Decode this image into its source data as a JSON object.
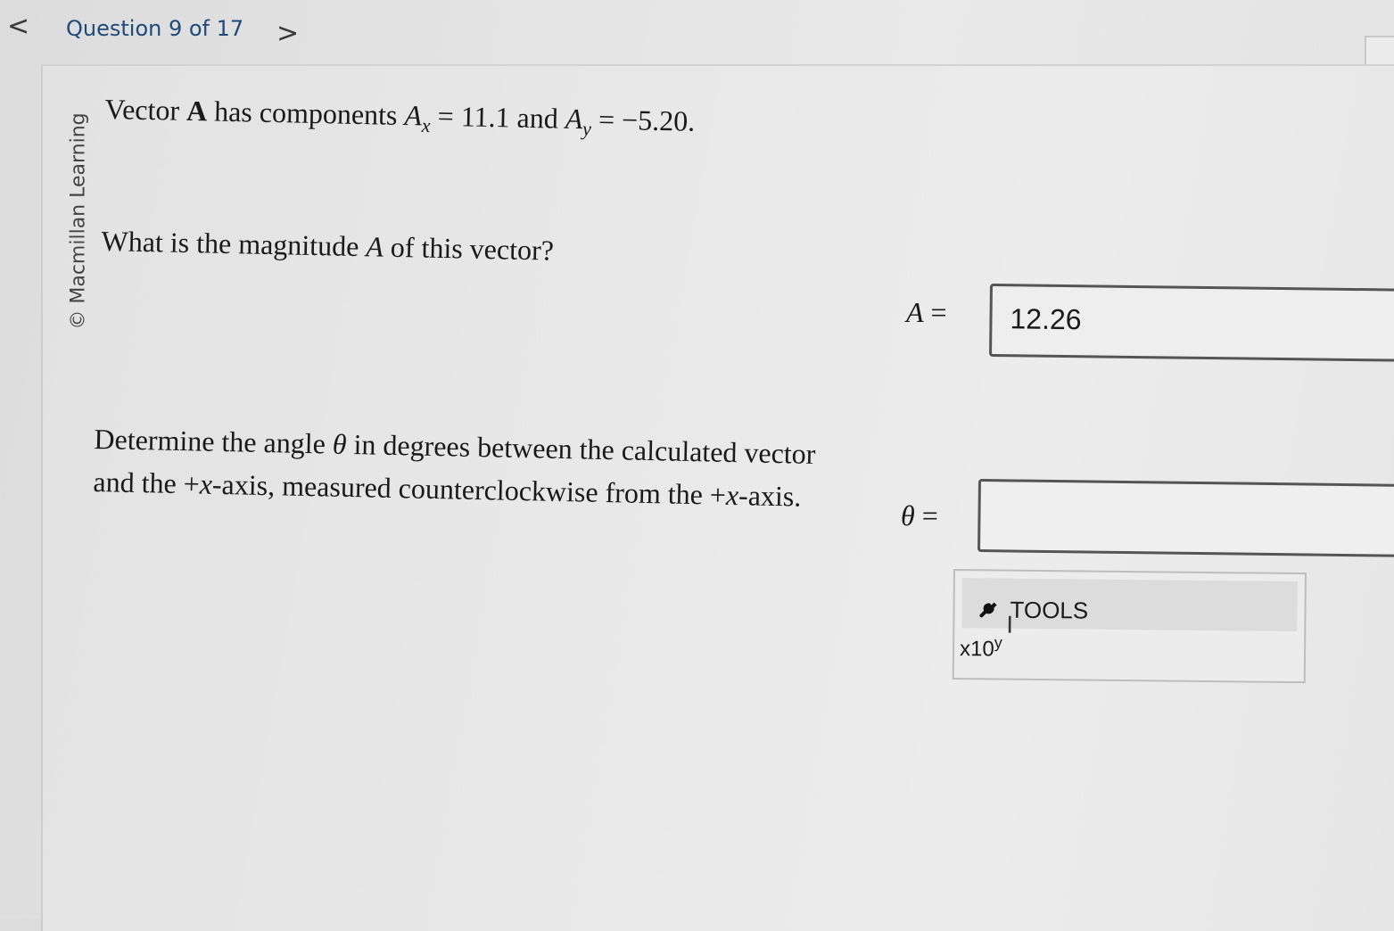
{
  "nav": {
    "prev_icon": "chevron-left-icon",
    "prev_glyph": "<",
    "question_counter": "Question 9 of 17",
    "next_icon": "chevron-right-icon",
    "next_glyph": ">"
  },
  "copyright": "© Macmillan Learning",
  "problem": {
    "stem_prefix": "Vector ",
    "vector_name": "A",
    "stem_mid": " has components ",
    "ax_symbol": "A",
    "ax_sub": "x",
    "ax_value": " = 11.1 and ",
    "ay_symbol": "A",
    "ay_sub": "y",
    "ay_value": " = −5.20."
  },
  "part_a": {
    "question_prefix": "What is the magnitude ",
    "question_symbol": "A",
    "question_suffix": " of this vector?",
    "label_symbol": "A",
    "label_eq": " =",
    "answer_value": "12.26"
  },
  "part_b": {
    "line1_prefix": "Determine the angle ",
    "theta": "θ",
    "line1_suffix": " in degrees between the calculated vector and the +",
    "x_symbol": "x",
    "line2_mid": "-axis, measured counterclockwise from the +",
    "x_symbol_2": "x",
    "line3_suffix": "-axis.",
    "label_symbol": "θ",
    "label_eq": " =",
    "answer_value": ""
  },
  "tools": {
    "icon": "wrench-icon",
    "label": "TOOLS",
    "x10_label": "x10",
    "x10_sup": "y",
    "cursor_icon": "text-cursor-icon",
    "cursor_glyph": "I"
  }
}
